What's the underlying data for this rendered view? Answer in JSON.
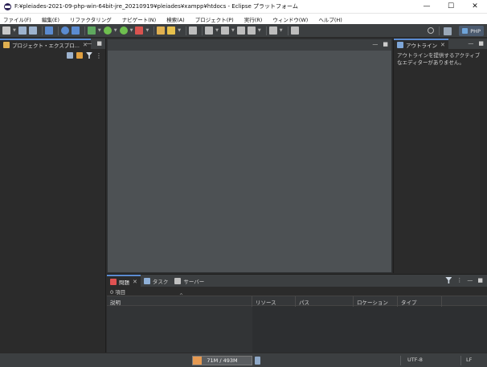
{
  "window": {
    "title": "F:¥pleiades-2021-09-php-win-64bit-jre_20210919¥pleiades¥xampp¥htdocs - Eclipse プラットフォーム",
    "minimize": "—",
    "maximize": "☐",
    "close": "✕"
  },
  "menu": [
    "ファイル(F)",
    "編集(E)",
    "リファクタリング",
    "ナビゲート(N)",
    "検索(A)",
    "プロジェクト(P)",
    "実行(R)",
    "ウィンドウ(W)",
    "ヘルプ(H)"
  ],
  "toolbar": {
    "perspective_label": "PHP",
    "colors": [
      "#c8c8c8",
      "#9db3cf",
      "#9db3cf",
      "#5b8bd0",
      "#5b8bd0",
      "#5b8bd0",
      "#5fa85f",
      "#6fbf4f",
      "#6fbf4f",
      "#d9534f",
      "#e0b050",
      "#e6c04c",
      "#bdbdbd",
      "#bdbdbd",
      "#bdbdbd",
      "#bdbdbd",
      "#bdbdbd",
      "#bdbdbd"
    ]
  },
  "project_explorer": {
    "tab_label": "プロジェクト・エクスプロ...",
    "close": "✕",
    "minimize": "—",
    "maximize": "■"
  },
  "outline": {
    "tab_label": "アウトライン",
    "close": "✕",
    "minimize": "—",
    "maximize": "■",
    "message": "アウトラインを提供するアクティブなエディターがありません。"
  },
  "editor": {
    "minimize": "—",
    "maximize": "■"
  },
  "problems": {
    "tabs": [
      {
        "label": "問題",
        "active": true,
        "icon_color": "#e05252"
      },
      {
        "label": "タスク",
        "active": false,
        "icon_color": "#8fb0d8"
      },
      {
        "label": "サーバー",
        "active": false,
        "icon_color": "#c0c0c0"
      }
    ],
    "close": "✕",
    "menu": "⋮",
    "minimize": "—",
    "maximize": "■",
    "items_count": "0 項目",
    "columns": [
      {
        "label": "説明"
      },
      {
        "label": "リソース"
      },
      {
        "label": "パス"
      },
      {
        "label": "ロケーション"
      },
      {
        "label": "タイプ"
      }
    ]
  },
  "status": {
    "heap": "71M / 493M",
    "heap_fraction": 0.144,
    "encoding": "UTF-8",
    "eol": "LF"
  },
  "colors": {
    "accent": "#5b8bd0",
    "background": "#2b2b2b",
    "editor": "#4d5154"
  }
}
